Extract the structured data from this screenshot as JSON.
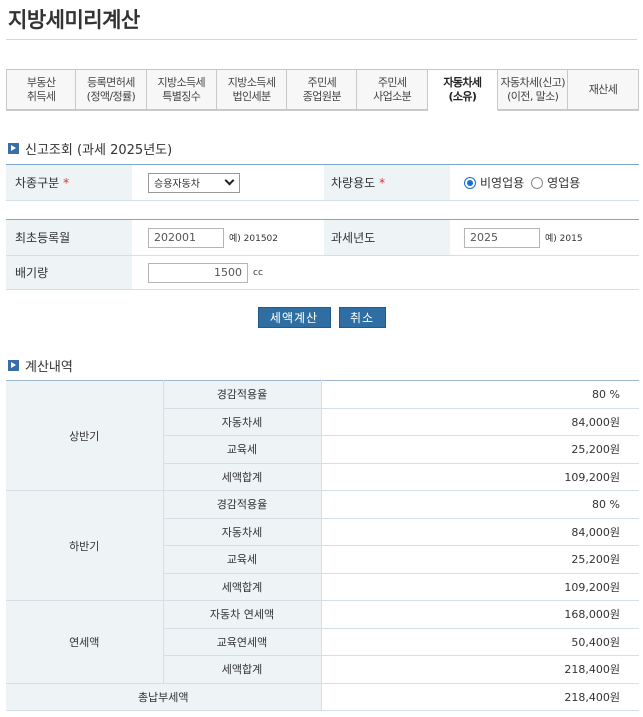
{
  "page_title": "지방세미리계산",
  "tabs": [
    {
      "line1": "부동산",
      "line2": "취득세",
      "active": false
    },
    {
      "line1": "등록면허세",
      "line2": "(정액/정률)",
      "active": false
    },
    {
      "line1": "지방소득세",
      "line2": "특별징수",
      "active": false
    },
    {
      "line1": "지방소득세",
      "line2": "법인세분",
      "active": false
    },
    {
      "line1": "주민세",
      "line2": "종업원분",
      "active": false
    },
    {
      "line1": "주민세",
      "line2": "사업소분",
      "active": false
    },
    {
      "line1": "자동차세",
      "line2": "(소유)",
      "active": true
    },
    {
      "line1": "자동차세(신고)",
      "line2": "(이전, 말소)",
      "active": false
    },
    {
      "line1": "재산세",
      "line2": "",
      "active": false
    }
  ],
  "inquiry": {
    "title": "신고조회",
    "subtitle": "(과세 2025년도)",
    "vehicle_type_label": "차종구분",
    "vehicle_type_value": "승용자동차",
    "vehicle_use_label": "차량용도",
    "use_option_1": "비영업용",
    "use_option_2": "영업용",
    "required_mark": "*",
    "first_reg_label": "최초등록월",
    "first_reg_value": "202001",
    "first_reg_hint": "예) 201502",
    "tax_year_label": "과세년도",
    "tax_year_value": "2025",
    "tax_year_hint": "예) 2015",
    "displacement_label": "배기량",
    "displacement_value": "1500",
    "displacement_unit": "cc"
  },
  "buttons": {
    "calculate": "세액계산",
    "cancel": "취소"
  },
  "result": {
    "title": "계산내역",
    "first_half": {
      "group": "상반기",
      "rows": [
        {
          "label": "경감적용율",
          "value": "80 %"
        },
        {
          "label": "자동차세",
          "value": "84,000원"
        },
        {
          "label": "교육세",
          "value": "25,200원"
        },
        {
          "label": "세액합계",
          "value": "109,200원"
        }
      ]
    },
    "second_half": {
      "group": "하반기",
      "rows": [
        {
          "label": "경감적용율",
          "value": "80 %"
        },
        {
          "label": "자동차세",
          "value": "84,000원"
        },
        {
          "label": "교육세",
          "value": "25,200원"
        },
        {
          "label": "세액합계",
          "value": "109,200원"
        }
      ]
    },
    "annual": {
      "group": "연세액",
      "rows": [
        {
          "label": "자동차 연세액",
          "value": "168,000원"
        },
        {
          "label": "교육연세액",
          "value": "50,400원"
        },
        {
          "label": "세액합계",
          "value": "218,400원"
        }
      ]
    },
    "total": {
      "label": "총납부세액",
      "value": "218,400원"
    }
  }
}
